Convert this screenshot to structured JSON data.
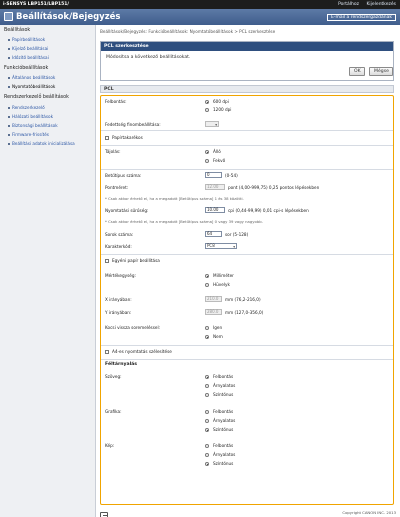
{
  "topbar": {
    "brand": "i-SENSYS LBP151/LBP151/",
    "link1": "Portálhoz",
    "link2": "Kijelentkezés"
  },
  "titlebar": {
    "title": "Beállítások/Bejegyzés",
    "email_button": "E-mail a rendszergazdának"
  },
  "sidebar": {
    "sec1": "Beállítások",
    "items1": [
      "Papírbeállítások",
      "Kijelző beállításai",
      "Időzítő beállításai"
    ],
    "sec2": "Funkcióbeállítások",
    "items2": [
      "Általános beállítások",
      "Nyomtatóbeállítások"
    ],
    "sec3": "Rendszerkezelő beállítások",
    "items3": [
      "Rendszerkezelő",
      "Hálózati beállítások",
      "Biztonsági beállítások",
      "Firmware-frissítés",
      "Beállítási adatok inicializálása"
    ]
  },
  "main": {
    "breadcrumb": "Beállítások/Bejegyzés: Funkcióbeállítások: Nyomtatóbeállítások > PCL szerkesztése",
    "panel_title": "PCL szerkesztése",
    "message": "Módosítsa a következő beállításokat.",
    "ok_label": "OK",
    "cancel_label": "Mégse",
    "section_title": "PCL"
  },
  "form": {
    "felbontas": "Felbontás:",
    "dpi600": "600 dpi",
    "dpi1200": "1200 dpi",
    "fedettseg": "Fedettség finombeállítása:",
    "fedettseg_value": "",
    "papirtakarekos": "Papírtakarékos",
    "tajolas": "Tájolás:",
    "allo": "Álló",
    "fekvo": "Fekvő",
    "betutipus": "Betűtípus száma:",
    "betutipus_value": "0",
    "betutipus_range": "(0-54)",
    "pontmeret": "Pontméret:",
    "pontmeret_value": "12.00",
    "pontmeret_range": "pont (4,00-999,75) 0,25 pontos lépésekben",
    "note1": "* Csak akkor érhető el, ha a megadott [Betűtípus száma] 1 és 38 közötti.",
    "nyomtatasi": "Nyomtatási sűrűség:",
    "nyomtatasi_value": "10.00",
    "nyomtatasi_range": "cpi (0,44-99,99) 0,01 cpi-s lépésekben",
    "note2": "* Csak akkor érhető el, ha a megadott [Betűtípus száma] 0 vagy 39 vagy nagyobb.",
    "sorok": "Sorok száma:",
    "sorok_value": "64",
    "sorok_range": "sor (5-128)",
    "karakterkod": "Karakterkód:",
    "karakterkod_value": "PC8",
    "egyeni": "Egyéni papír beállítása",
    "mertekegyseg": "Mértékegység:",
    "milli": "Milliméter",
    "huvelyk": "Hüvelyk",
    "xirany": "X irányában:",
    "xirany_value": "210.0",
    "xirany_range": "mm (76,2-216,0)",
    "yirany": "Y irányában:",
    "yirany_value": "280.0",
    "yirany_range": "mm (127,0-356,0)",
    "kocsi": "Kocsi vissza soremeléssel:",
    "igen": "Igen",
    "nem": "Nem",
    "a4": "A4-es nyomtatás szélesítése",
    "felarnyekolas": "Féltárnyalás",
    "szoveg": "Szöveg:",
    "grafika": "Grafika:",
    "kep": "Kép:",
    "felbontas_opt": "Felbontás",
    "arnyalatos": "Árnyalatos",
    "szinarnyalat": "Színtónus"
  },
  "copyright": "Copyright CANON INC. 2013",
  "colors": {
    "form_border": "#f0a400",
    "panel_head": "#2f4f7f",
    "titlebar": "#3f5d8c"
  }
}
